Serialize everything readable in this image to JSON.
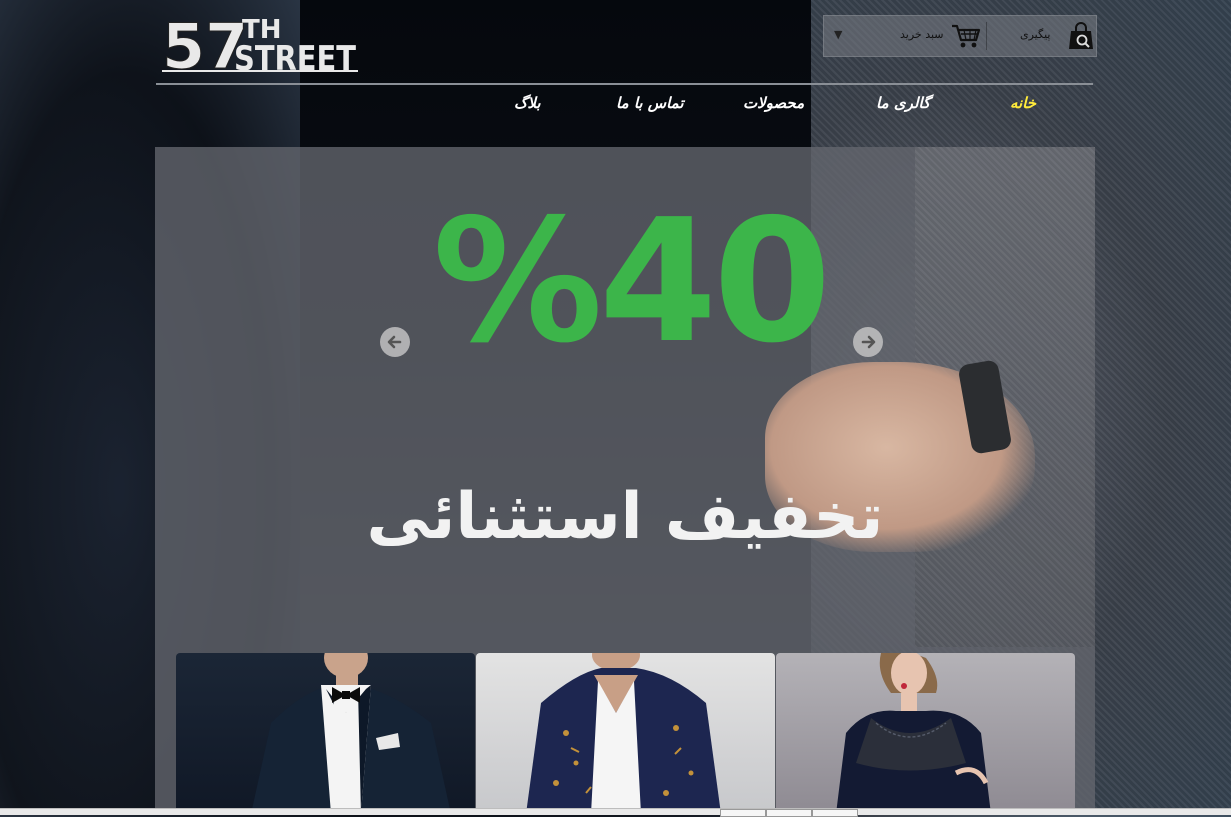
{
  "brand": {
    "logo_text": "57TH STREET"
  },
  "topbar": {
    "cart_label": "سبد خرید",
    "track_label": "پیگیری",
    "dropdown_symbol": "▼"
  },
  "nav": {
    "items": [
      {
        "label": "خانه",
        "active": true
      },
      {
        "label": "گالری ما",
        "active": false
      },
      {
        "label": "محصولات",
        "active": false
      },
      {
        "label": "تماس با ما",
        "active": false
      },
      {
        "label": "بلاگ",
        "active": false
      }
    ]
  },
  "slider": {
    "discount_text": "%40",
    "headline": "تخفیف استثنائی",
    "accent_color": "#3cb54a"
  },
  "products": [
    {
      "icon": "tuxedo-image"
    },
    {
      "icon": "hoodie-image"
    },
    {
      "icon": "lace-dress-image"
    }
  ]
}
